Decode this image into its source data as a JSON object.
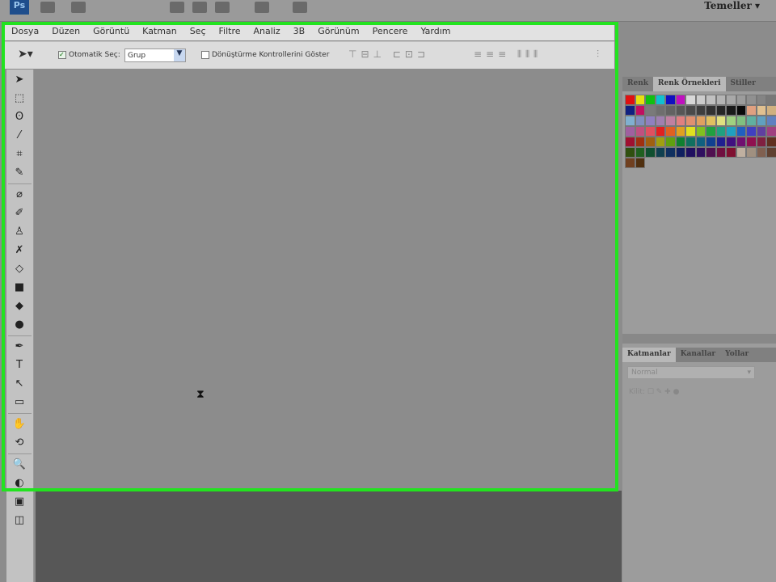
{
  "app": {
    "logo": "Ps",
    "workspace": "Temeller ▾"
  },
  "menu": [
    "Dosya",
    "Düzen",
    "Görüntü",
    "Katman",
    "Seç",
    "Filtre",
    "Analiz",
    "3B",
    "Görünüm",
    "Pencere",
    "Yardım"
  ],
  "options": {
    "auto_select_label": "Otomatik Seç:",
    "auto_select_value": "Grup",
    "transform_label": "Dönüştürme Kontrollerini Göster"
  },
  "tools": [
    "➤",
    "⬚",
    "ʘ",
    "⁄",
    "⌗",
    "✎",
    "|",
    "⌀",
    "✐",
    "♙",
    "✗",
    "◇",
    "■",
    "◆",
    "●",
    "|",
    "✒",
    "T",
    "↖",
    "▭",
    "|",
    "✋",
    "⟲",
    "|",
    "🔍",
    "◐",
    "▣",
    "◫"
  ],
  "swatch_panel": {
    "tabs": [
      "Renk",
      "Renk Örnekleri",
      "Stiller"
    ],
    "active": 1,
    "colors": [
      "#e01010",
      "#e8e010",
      "#10c010",
      "#10c0d0",
      "#1010c0",
      "#c010c0",
      "#d8d8d8",
      "#cccccc",
      "#c0c0c0",
      "#b4b4b4",
      "#a8a8a8",
      "#9c9c9c",
      "#909090",
      "#848484",
      "#787878",
      "#102080",
      "#c01060",
      "#7a7a7a",
      "#6e6e6e",
      "#626262",
      "#565656",
      "#4a4a4a",
      "#3e3e3e",
      "#323232",
      "#262626",
      "#1a1a1a",
      "#0a0a0a",
      "#e0a080",
      "#e0c090",
      "#d0b080",
      "#80b0d0",
      "#8090c0",
      "#9080c0",
      "#a080b0",
      "#c080a0",
      "#e08080",
      "#e09070",
      "#e0a060",
      "#e0c060",
      "#e0e080",
      "#a0d080",
      "#80c080",
      "#60b0a0",
      "#60a0c0",
      "#6080c0",
      "#a060a0",
      "#c05080",
      "#e05060",
      "#e02020",
      "#e06020",
      "#e0a020",
      "#e0e020",
      "#80c020",
      "#20a040",
      "#20a080",
      "#20a0c0",
      "#2060c0",
      "#4040c0",
      "#6040a0",
      "#a04080",
      "#a01030",
      "#a03010",
      "#a06010",
      "#a0a010",
      "#60a010",
      "#108030",
      "#107060",
      "#106080",
      "#104090",
      "#202090",
      "#401080",
      "#701070",
      "#901050",
      "#802040",
      "#603020",
      "#305010",
      "#206020",
      "#105030",
      "#104050",
      "#103060",
      "#102060",
      "#201060",
      "#301060",
      "#501050",
      "#701040",
      "#801030",
      "#c0b0a0",
      "#a09080",
      "#806050",
      "#604030",
      "#704020",
      "#503010"
    ]
  },
  "layers_panel": {
    "tabs": [
      "Katmanlar",
      "Kanallar",
      "Yollar"
    ],
    "active": 0,
    "blend_mode": "Normal",
    "lock_label": "Kilit:"
  }
}
